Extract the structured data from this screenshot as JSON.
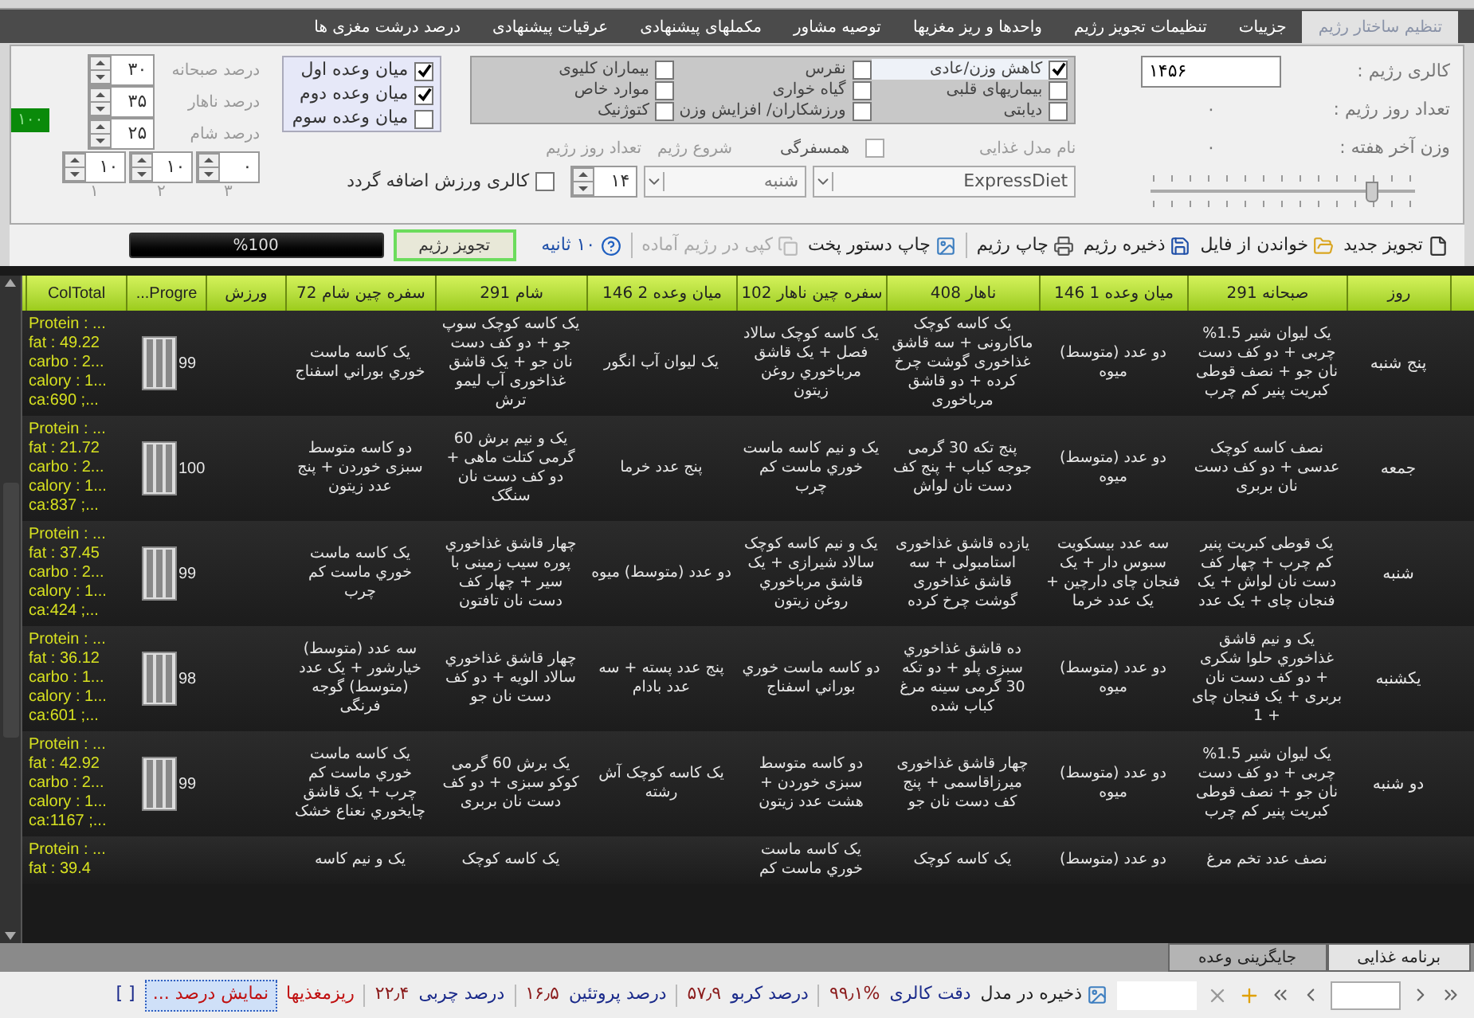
{
  "tabs": [
    {
      "label": "تنظیم ساختار رژیم",
      "selected": true
    },
    {
      "label": "جزییات",
      "selected": false
    },
    {
      "label": "تنظیمات تجویز رژیم",
      "selected": false
    },
    {
      "label": "واحدها و ریز مغزیها",
      "selected": false
    },
    {
      "label": "توصیه مشاور",
      "selected": false
    },
    {
      "label": "مکملهای پیشنهادی",
      "selected": false
    },
    {
      "label": "عرقیات پیشنهادی",
      "selected": false
    },
    {
      "label": "درصد درشت مغزی ها",
      "selected": false
    }
  ],
  "settings": {
    "info": [
      {
        "label": "کالری  رژیم :",
        "value": "۱۴۵۶",
        "kind": "field"
      },
      {
        "label": "تعداد روز رژیم :",
        "value": "۰",
        "kind": "text"
      },
      {
        "label": "وزن آخر هفته :",
        "value": "۰",
        "kind": "text"
      }
    ],
    "slider": {
      "level": 0.84
    },
    "diet_types": [
      {
        "label": "کاهش وزن/عادی",
        "checked": true
      },
      {
        "label": "بیماریهای قلبی",
        "checked": false
      },
      {
        "label": "دیابتی",
        "checked": false
      },
      {
        "label": "نقرس",
        "checked": false
      },
      {
        "label": "گیاه خواری",
        "checked": false
      },
      {
        "label": "ورزشکاران/ افزایش وزن",
        "checked": false
      },
      {
        "label": "بیماران کلیوی",
        "checked": false
      },
      {
        "label": "موارد خاص",
        "checked": false
      },
      {
        "label": "کتوژنیک",
        "checked": false
      }
    ],
    "model_label": "نام مدل غذایی",
    "travel": {
      "label": "همسفرگی",
      "checked": false
    },
    "start_label": "شروع رژیم",
    "days_label": "تعداد روز رژیم",
    "model_value": "ExpressDiet",
    "start_value": "شنبه",
    "days_value": "۱۴",
    "exercise": {
      "label": "کالری ورزش اضافه گردد",
      "checked": false
    },
    "snacks": [
      {
        "label": "میان وعده اول",
        "checked": true
      },
      {
        "label": "میان وعده دوم",
        "checked": true
      },
      {
        "label": "میان وعده سوم",
        "checked": false
      }
    ],
    "meal_percents": [
      {
        "label": "درصد صبحانه",
        "value": "۳۰"
      },
      {
        "label": "درصد ناهار",
        "value": "۳۵"
      },
      {
        "label": "درصد شام",
        "value": "۲۵"
      }
    ],
    "snack_percents": [
      {
        "label": "۳",
        "value": "۰"
      },
      {
        "label": "۲",
        "value": "۱۰"
      },
      {
        "label": "۱",
        "value": "۱۰"
      }
    ],
    "total_badge": "۱۰۰"
  },
  "toolbar": [
    {
      "label": "تجویز جدید",
      "disabled": false
    },
    {
      "label": "خواندن از فایل",
      "disabled": false
    },
    {
      "label": "ذخیره رژیم",
      "disabled": false
    },
    {
      "label": "چاپ رژیم",
      "disabled": false
    },
    {
      "label": "چاپ دستور پخت",
      "disabled": false
    },
    {
      "label": "کپی در رژیم آماده",
      "disabled": true
    },
    {
      "label": "۱۰ ثانیه",
      "disabled": false
    }
  ],
  "prescribe_button": "تجویز رژیم",
  "progress": {
    "level": 1,
    "label": "%100"
  },
  "table": {
    "columns": [
      {
        "label": "روز",
        "kind": "day"
      },
      {
        "label": "صبحانه 291",
        "kind": "text"
      },
      {
        "label": "میان وعده 1 146",
        "kind": "text"
      },
      {
        "label": "ناهار 408",
        "kind": "text"
      },
      {
        "label": "سفره چین ناهار 102",
        "kind": "text"
      },
      {
        "label": "میان وعده 2 146",
        "kind": "text"
      },
      {
        "label": "شام 291",
        "kind": "text"
      },
      {
        "label": "سفره چین شام 72",
        "kind": "text"
      },
      {
        "label": "ورزش",
        "kind": "text"
      },
      {
        "label": "Progre...",
        "kind": "progress"
      },
      {
        "label": "ColTotal",
        "kind": "totals"
      }
    ],
    "rows": [
      {
        "cells": [
          "پنج شنبه",
          "یک لیوان شیر 1.5% چربی + دو کف دست  نان جو + نصف قوطی کبریت پنیر کم چرب",
          "دو عدد (متوسط) میوه",
          "یک کاسه کوچک ماکارونی + سه قاشق غذاخوری گوشت چرخ کرده + دو قاشق مرباخوری",
          "یک کاسه کوچک سالاد فصل + یک قاشق مرباخوري روغن زيتون",
          "یک لیوان آب انگور",
          "یک کاسه کوچک سوپ جو + دو کف دست  نان جو + یک قاشق غذاخوری آب لیمو ترش",
          "یک کاسه ماست خوري بوراني اسفناج",
          null,
          "99",
          [
            "Protein : ...",
            "fat : 49.22",
            "carbo : 2...",
            "calory : 1...",
            "ca:690 ;..."
          ]
        ]
      },
      {
        "cells": [
          "جمعه",
          "نصف کاسه کوچک عدسی + دو کف دست  نان بربری",
          "دو عدد (متوسط) میوه",
          "پنج تکه 30 گرمی جوجه کباب + پنج کف دست  نان لواش",
          "یک و نیم کاسه ماست خوري ماست کم چرب",
          "پنج عدد خرما",
          "یک و نیم برش 60 گرمی کتلت ماهی + دو کف دست نان سنگک",
          "دو کاسه متوسط سبزی خوردن + پنج عدد زیتون",
          null,
          "100",
          [
            "Protein : ...",
            "fat : 21.72",
            "carbo : 2...",
            "calory : 1...",
            "ca:837 ;..."
          ]
        ]
      },
      {
        "cells": [
          "شنبه",
          "یک قوطی کبریت پنیر کم چرب + چهار کف دست  نان لواش + یک فنجان چای + یک عدد",
          "سه عدد بیسکویت سبوس دار + یک فنجان چای دارچین + یک عدد خرما",
          "یازده قاشق غذاخوری استامبولی + سه قاشق غذاخوری گوشت چرخ کرده",
          "یک و نیم کاسه کوچک سالاد شیرازی + یک قاشق مرباخوري روغن زيتون",
          "دو عدد (متوسط) میوه",
          "چهار قاشق غذاخوري پوره سیب زمینی با سیر + چهار کف دست  نان تافتون",
          "یک کاسه ماست خوري ماست کم چرب",
          null,
          "99",
          [
            "Protein : ...",
            "fat : 37.45",
            "carbo : 2...",
            "calory : 1...",
            "ca:424 ;..."
          ]
        ]
      },
      {
        "cells": [
          "یکشنبه",
          "یک و نیم قاشق غذاخوري حلوا شکری + دو کف دست  نان بربری + یک فنجان چای + 1",
          "دو عدد (متوسط) میوه",
          "ده قاشق غذاخوري سبزی پلو + دو تکه 30 گرمی سینه مرغ کباب شده",
          "دو کاسه ماست خوري بوراني اسفناج",
          "پنج عدد پسته + سه عدد بادام",
          "چهار قاشق غذاخوري سالاد الويه + دو کف دست  نان جو",
          "سه عدد (متوسط) خیارشور + یک عدد (متوسط) گوجه فرنگی",
          null,
          "98",
          [
            "Protein : ...",
            "fat : 36.12",
            "carbo : 1...",
            "calory : 1...",
            "ca:601 ;..."
          ]
        ]
      },
      {
        "cells": [
          "دو شنبه",
          "یک لیوان شیر 1.5% چربی + دو کف دست  نان جو + نصف قوطی کبریت پنیر کم چرب",
          "دو عدد (متوسط) میوه",
          "چهار قاشق غذاخوری میرزاقاسمی + پنج کف دست  نان جو",
          "دو کاسه متوسط سبزی خوردن + هشت عدد زیتون",
          "یک کاسه کوچک آش رشته",
          "یک برش 60 گرمی کوکو سبزی + دو کف دست  نان بربری",
          "یک کاسه ماست خوري ماست کم چرب + یک قاشق چایخوري نعناع خشک",
          null,
          "99",
          [
            "Protein : ...",
            "fat : 42.92",
            "carbo : 2...",
            "calory : 1...",
            "ca:1167 ;..."
          ]
        ]
      },
      {
        "cells": [
          null,
          "نصف عدد تخم مرغ",
          "دو عدد (متوسط)",
          "یک کاسه کوچک",
          "یک کاسه ماست خوري ماست کم",
          null,
          "یک کاسه کوچک",
          "یک و نیم کاسه",
          null,
          null,
          [
            "Protein : ...",
            "fat : 39.4"
          ]
        ]
      }
    ]
  },
  "bottom_tabs": [
    {
      "label": "برنامه غذایی",
      "selected": true
    },
    {
      "label": "جایگزینی وعده",
      "selected": false
    }
  ],
  "status": {
    "save_label": "ذخیره در مدل",
    "stats": [
      {
        "label": "دقت کالری",
        "value": "۹۹٫۱%"
      },
      {
        "label": "درصد کربو",
        "value": "۵۷٫۹"
      },
      {
        "label": "درصد پروتئین",
        "value": "۱۶٫۵"
      },
      {
        "label": "درصد چربی",
        "value": "۲۲٫۴"
      }
    ],
    "micro_link": "ریزمغذیها",
    "show_button": "نمایش درصد ...",
    "brackets": "[ ]"
  }
}
